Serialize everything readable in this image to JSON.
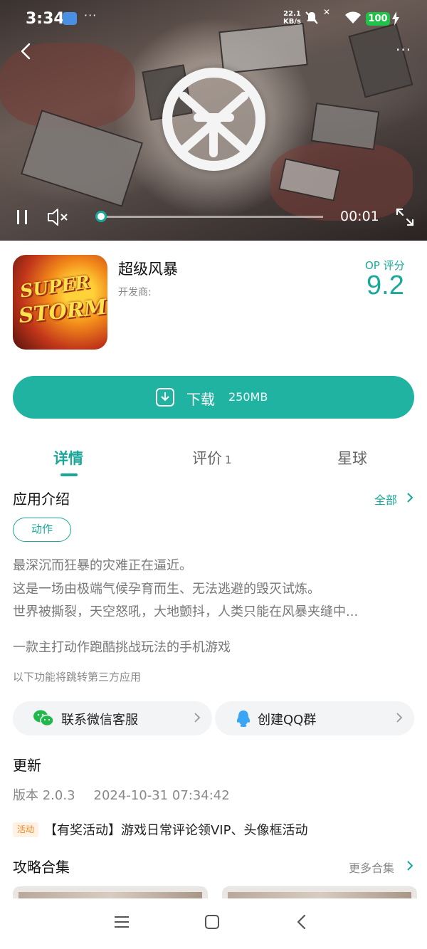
{
  "status_bar": {
    "time": "3:34",
    "dots": "···",
    "speed_value": "22.1",
    "speed_unit": "KB/s",
    "battery": "100"
  },
  "video": {
    "timecode": "00:01",
    "progress_fraction": 0.0
  },
  "app": {
    "title": "超级风暴",
    "developer_label": "开发商:",
    "icon_text_line1": "SUPER",
    "icon_text_line2": "STORM",
    "rating_label": "OP 评分",
    "rating_value": "9.2"
  },
  "download": {
    "label": "下载",
    "size": "250MB"
  },
  "tabs": [
    {
      "label": "详情",
      "count": ""
    },
    {
      "label": "评价",
      "count": "1"
    },
    {
      "label": "星球",
      "count": ""
    }
  ],
  "intro": {
    "title": "应用介绍",
    "all_link": "全部",
    "tag": "动作",
    "description": [
      "最深沉而狂暴的灾难正在逼近。",
      "这是一场由极端气候孕育而生、无法逃避的毁灭试炼。",
      "世界被撕裂，天空怒吼，大地颤抖，人类只能在风暴夹缝中..."
    ],
    "summary": "一款主打动作跑酷挑战玩法的手机游戏",
    "third_party_note": "以下功能将跳转第三方应用"
  },
  "contacts": {
    "wechat_label": "联系微信客服",
    "qq_label": "创建QQ群"
  },
  "update": {
    "title": "更新",
    "version": "版本 2.0.3",
    "date": "2024-10-31 07:34:42"
  },
  "activity": {
    "tag": "活动",
    "text": "【有奖活动】游戏日常评论领VIP、头像框活动"
  },
  "guides": {
    "title": "攻略合集",
    "more_link": "更多合集"
  },
  "colors": {
    "accent": "#1aa89a",
    "download_button": "#20b3a2",
    "activity_tag": "#f08a24"
  }
}
